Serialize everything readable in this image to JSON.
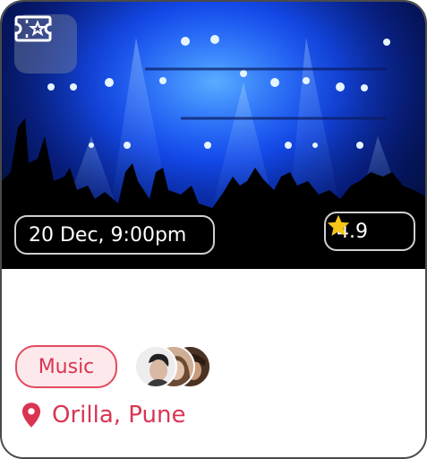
{
  "event": {
    "date_time": "20 Dec, 9:00pm",
    "rating": "4.9",
    "category": "Music",
    "location": "Orilla, Pune"
  },
  "icons": {
    "ticket": "ticket-star-icon",
    "rating": "star-icon",
    "location": "map-pin-icon"
  },
  "colors": {
    "accent": "#d93552",
    "tag_bg": "#fde9ec",
    "star": "#f5c518",
    "border": "#4a4a4a"
  }
}
